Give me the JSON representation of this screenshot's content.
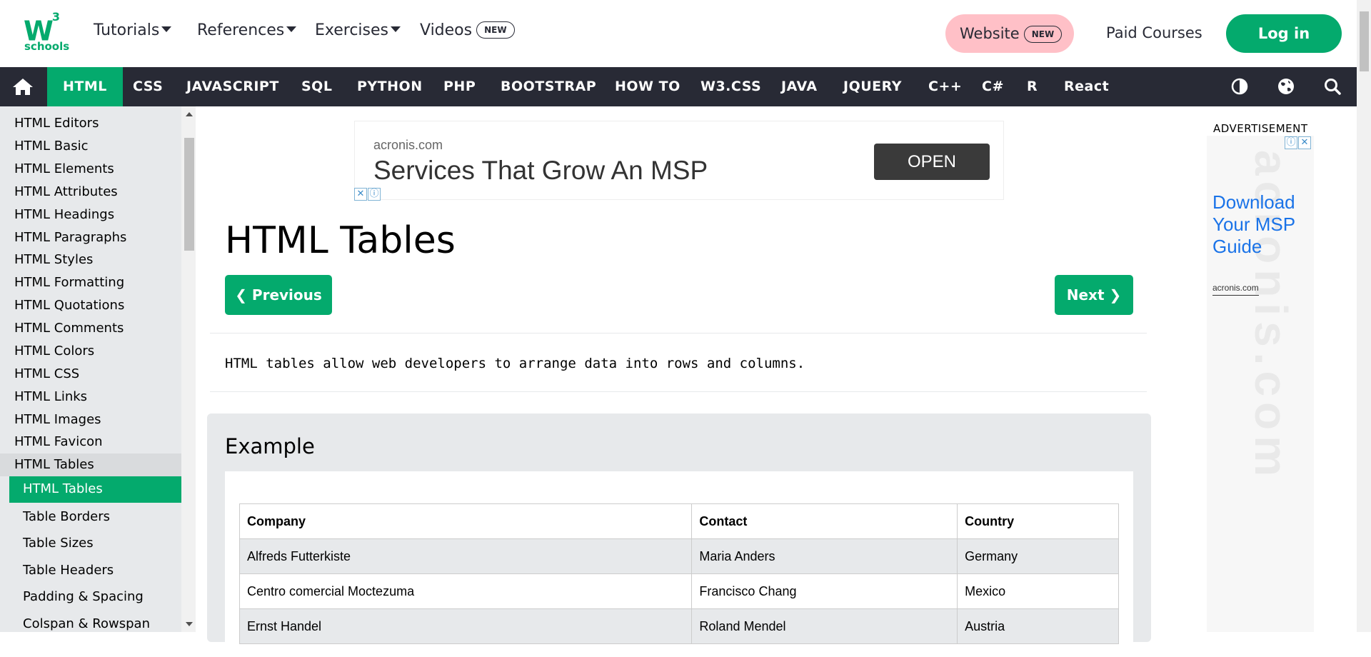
{
  "header": {
    "logo_main": "W",
    "logo_sup": "3",
    "logo_sub": "schools",
    "menu": [
      {
        "label": "Tutorials",
        "dropdown": true
      },
      {
        "label": "References",
        "dropdown": true
      },
      {
        "label": "Exercises",
        "dropdown": true
      },
      {
        "label": "Videos",
        "badge": "NEW"
      }
    ],
    "website": {
      "label": "Website",
      "badge": "NEW"
    },
    "paid_courses": "Paid Courses",
    "login": "Log in"
  },
  "nav": {
    "links": [
      "HTML",
      "CSS",
      "JAVASCRIPT",
      "SQL",
      "PYTHON",
      "PHP",
      "BOOTSTRAP",
      "HOW TO",
      "W3.CSS",
      "JAVA",
      "JQUERY",
      "C++",
      "C#",
      "R",
      "React"
    ],
    "active": "HTML",
    "icons": [
      "home-icon",
      "contrast-icon",
      "globe-icon",
      "search-icon"
    ]
  },
  "sidebar": {
    "items": [
      "HTML Editors",
      "HTML Basic",
      "HTML Elements",
      "HTML Attributes",
      "HTML Headings",
      "HTML Paragraphs",
      "HTML Styles",
      "HTML Formatting",
      "HTML Quotations",
      "HTML Comments",
      "HTML Colors",
      "HTML CSS",
      "HTML Links",
      "HTML Images",
      "HTML Favicon"
    ],
    "group": "HTML Tables",
    "active_sub": "HTML Tables",
    "subitems": [
      "Table Borders",
      "Table Sizes",
      "Table Headers",
      "Padding & Spacing",
      "Colspan & Rowspan"
    ]
  },
  "top_ad": {
    "domain": "acronis.com",
    "headline": "Services That Grow An MSP",
    "button": "OPEN",
    "close_glyph": "✕",
    "info_glyph": "ⓘ"
  },
  "main": {
    "title": "HTML Tables",
    "prev_label": "❮ Previous",
    "next_label": "Next ❯",
    "intro": "HTML tables allow web developers to arrange data into rows and columns.",
    "example_heading": "Example",
    "table": {
      "headers": [
        "Company",
        "Contact",
        "Country"
      ],
      "rows": [
        [
          "Alfreds Futterkiste",
          "Maria Anders",
          "Germany"
        ],
        [
          "Centro comercial Moctezuma",
          "Francisco Chang",
          "Mexico"
        ],
        [
          "Ernst Handel",
          "Roland Mendel",
          "Austria"
        ]
      ]
    }
  },
  "side_ad": {
    "label": "ADVERTISEMENT",
    "headline": "Download Your MSP Guide",
    "domain": "acronis.com",
    "watermark": "acronis.com"
  },
  "colors": {
    "brand_green": "#04AA6D",
    "dark_nav": "#282A35",
    "website_pink": "#FFC0C7",
    "panel_grey": "#E7E9EB"
  }
}
